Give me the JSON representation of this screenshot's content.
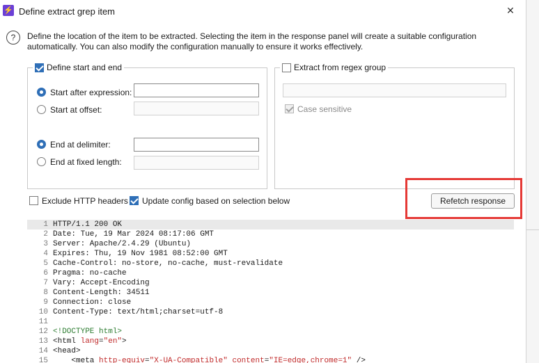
{
  "window": {
    "title": "Define extract grep item",
    "close_glyph": "✕",
    "app_glyph": "⚡"
  },
  "description": "Define the location of the item to be extracted. Selecting the item in the response panel will create a suitable configuration automatically. You can also modify the configuration manually to ensure it works effectively.",
  "start_end_group": {
    "label": "Define start and end",
    "checked": true,
    "start_after_expression": {
      "label": "Start after expression:",
      "value": ""
    },
    "start_at_offset": {
      "label": "Start at offset:",
      "value": ""
    },
    "end_at_delimiter": {
      "label": "End at delimiter:",
      "value": ""
    },
    "end_at_fixed_length": {
      "label": "End at fixed length:",
      "value": ""
    }
  },
  "regex_group": {
    "label": "Extract from regex group",
    "checked": false,
    "regex_value": "",
    "case_sensitive_label": "Case sensitive"
  },
  "options": {
    "exclude_headers_label": "Exclude HTTP headers",
    "update_config_label": "Update config based on selection below"
  },
  "refetch_label": "Refetch response",
  "response_lines": [
    {
      "n": "1",
      "t": "HTTP/1.1 200 OK"
    },
    {
      "n": "2",
      "t": "Date: Tue, 19 Mar 2024 08:17:06 GMT"
    },
    {
      "n": "3",
      "t": "Server: Apache/2.4.29 (Ubuntu)"
    },
    {
      "n": "4",
      "t": "Expires: Thu, 19 Nov 1981 08:52:00 GMT"
    },
    {
      "n": "5",
      "t": "Cache-Control: no-store, no-cache, must-revalidate"
    },
    {
      "n": "6",
      "t": "Pragma: no-cache"
    },
    {
      "n": "7",
      "t": "Vary: Accept-Encoding"
    },
    {
      "n": "8",
      "t": "Content-Length: 34511"
    },
    {
      "n": "9",
      "t": "Connection: close"
    },
    {
      "n": "10",
      "t": "Content-Type: text/html;charset=utf-8"
    },
    {
      "n": "11",
      "t": ""
    },
    {
      "n": "12",
      "t": "<!DOCTYPE html>"
    },
    {
      "n": "13",
      "t": "<html lang=\"en\">"
    },
    {
      "n": "14",
      "t": "<head>"
    },
    {
      "n": "15",
      "t": "    <meta http-equiv=\"X-UA-Compatible\" content=\"IE=edge,chrome=1\" />"
    }
  ],
  "colors": {
    "accent": "#2f6fb7",
    "highlight": "#e53935",
    "html_attr": "#c02a2a",
    "doctype": "#2e7d32"
  }
}
